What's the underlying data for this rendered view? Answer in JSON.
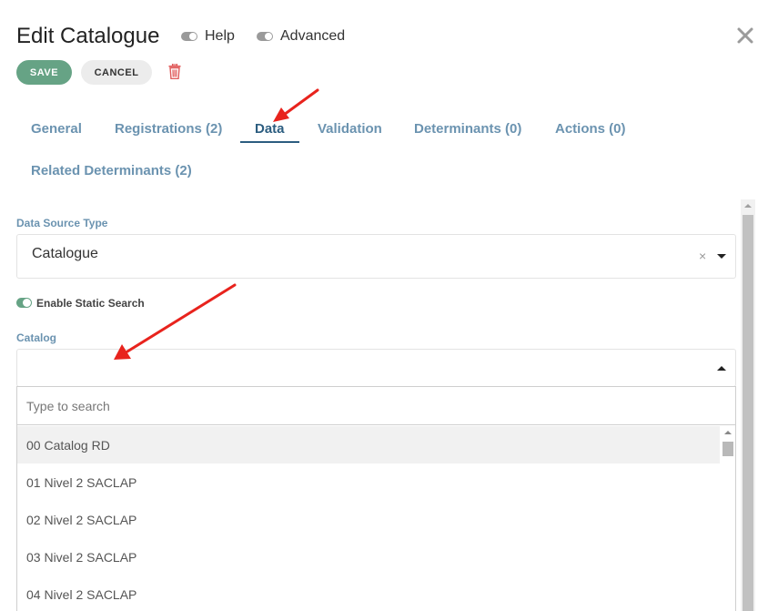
{
  "header": {
    "title": "Edit Catalogue",
    "help_label": "Help",
    "advanced_label": "Advanced",
    "close_icon": "close-icon"
  },
  "toolbar": {
    "save_label": "SAVE",
    "cancel_label": "CANCEL",
    "delete_icon": "trash-icon"
  },
  "tabs": [
    {
      "label": "General"
    },
    {
      "label": "Registrations (2)"
    },
    {
      "label": "Data",
      "active": true
    },
    {
      "label": "Validation"
    },
    {
      "label": "Determinants (0)"
    },
    {
      "label": "Actions (0)"
    },
    {
      "label": "Related Determinants (2)"
    }
  ],
  "form": {
    "data_source_type": {
      "label": "Data Source Type",
      "value": "Catalogue"
    },
    "static_search": {
      "label": "Enable Static Search",
      "enabled": true
    },
    "catalog": {
      "label": "Catalog",
      "value": "",
      "search_placeholder": "Type to search",
      "options": [
        {
          "label": "00 Catalog RD",
          "highlighted": true
        },
        {
          "label": "01 Nivel 2 SACLAP"
        },
        {
          "label": "02 Nivel 2 SACLAP"
        },
        {
          "label": "03 Nivel 2 SACLAP"
        },
        {
          "label": "04 Nivel 2 SACLAP"
        }
      ]
    }
  },
  "colors": {
    "accent_green": "#66a385",
    "tab_blue": "#6b93b0",
    "tab_active": "#2c5d80",
    "annotation_red": "#e8231d",
    "delete_red": "#e05a5a"
  }
}
